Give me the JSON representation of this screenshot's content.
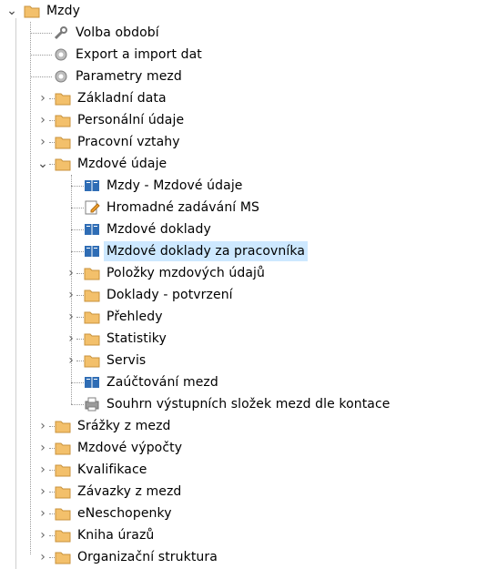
{
  "tree": {
    "root": {
      "label": "Mzdy",
      "icon": "folder-icon",
      "expanded": true
    },
    "level1_a": [
      {
        "label": "Volba období",
        "icon": "wrench-icon"
      },
      {
        "label": "Export a import dat",
        "icon": "gear-icon"
      },
      {
        "label": "Parametry mezd",
        "icon": "gear-icon"
      }
    ],
    "level1_b": [
      {
        "label": "Základní data",
        "icon": "folder-icon"
      },
      {
        "label": "Personální údaje",
        "icon": "folder-icon"
      },
      {
        "label": "Pracovní vztahy",
        "icon": "folder-icon"
      }
    ],
    "mzdove_udaje": {
      "label": "Mzdové údaje",
      "icon": "folder-icon",
      "expanded": true
    },
    "level2_leaves": [
      {
        "label": "Mzdy - Mzdové údaje",
        "icon": "book-icon"
      },
      {
        "label": "Hromadné zadávání MS",
        "icon": "edit-form-icon"
      },
      {
        "label": "Mzdové doklady",
        "icon": "book-icon"
      },
      {
        "label": "Mzdové doklady za pracovníka",
        "icon": "book-icon",
        "selected": true
      }
    ],
    "level2_folders": [
      {
        "label": "Položky mzdových údajů",
        "icon": "folder-icon"
      },
      {
        "label": "Doklady - potvrzení",
        "icon": "folder-icon"
      },
      {
        "label": "Přehledy",
        "icon": "folder-icon"
      },
      {
        "label": "Statistiky",
        "icon": "folder-icon"
      },
      {
        "label": "Servis",
        "icon": "folder-icon"
      }
    ],
    "level2_tail": [
      {
        "label": "Zaúčtování mezd",
        "icon": "book-icon"
      },
      {
        "label": "Souhrn výstupních složek mezd dle kontace",
        "icon": "printer-icon"
      }
    ],
    "level1_c": [
      {
        "label": "Srážky z mezd",
        "icon": "folder-icon"
      },
      {
        "label": "Mzdové výpočty",
        "icon": "folder-icon"
      },
      {
        "label": "Kvalifikace",
        "icon": "folder-icon"
      },
      {
        "label": "Závazky z mezd",
        "icon": "folder-icon"
      },
      {
        "label": "eNeschopenky",
        "icon": "folder-icon"
      },
      {
        "label": "Kniha úrazů",
        "icon": "folder-icon"
      },
      {
        "label": "Organizační struktura",
        "icon": "folder-icon"
      }
    ]
  },
  "colors": {
    "selection": "#cde8ff",
    "folder": "#f3c06b",
    "book": "#2f6db5"
  }
}
